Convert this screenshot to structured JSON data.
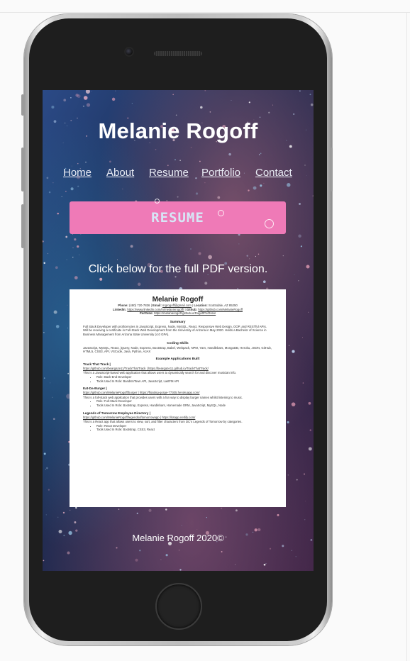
{
  "site": {
    "title": "Melanie Rogoff",
    "nav": [
      "Home",
      "About",
      "Resume",
      "Portfolio",
      "Contact"
    ],
    "banner": "RESUME",
    "pdf_note": "Click below for the full PDF version.",
    "footer": "Melanie Rogoff 2020©"
  },
  "resume": {
    "name": "Melanie Rogoff",
    "contact_line": {
      "phone_label": "Phone:",
      "phone": "(480) 720-7836",
      "email_label": "Email:",
      "email": "mgrogoff@gmail.com",
      "location_label": "Location:",
      "location": "Scottsdale, AZ 85250"
    },
    "links_line": {
      "linkedin_label": "LinkedIn:",
      "linkedin": "https://www.linkedin.com/in/melanierogoff/",
      "github_label": "Github:",
      "github": "https://github.com/MelanieRogoff"
    },
    "portfolio_line": {
      "label": "Portfolio:",
      "url": "https://melanierogoff.github.io/RogoffPortfolio/"
    },
    "summary_heading": "Summary",
    "summary": "Full Stack Developer with proficiencies in JavaScript, Express, Node, MySQL, React, Responsive Web Design, OOP, and RESTful APIs. Will be receiving a certificate in Full-Stack Web Development from the University of Arizona in May 2020. Holds a Bachelor of Science in Business Management from Arizona State University (4.0 GPA).",
    "skills_heading": "Coding Skills",
    "skills": "JavaScript, MySQL, React, jQuery, Node, Express, Bootstrap, Babel, Webpack, NPM, Yarn, Handlebars, MongoDB, Heroku, JSON, GitHub, HTML5, CSS3, API, VSCode, Java, Python, AJAX",
    "apps_heading": "Example Applications Built",
    "apps": [
      {
        "name": "Track That Track |",
        "links": "https://github.com/beargaze11/TrackThatTrack | https://beargaze11.github.io/TrackThatTrack/",
        "desc": "This is a JavaScript-based web application that allows users to dynamically search for and discover musician info.",
        "bullets": [
          "Role: Back-End Developer",
          "Tools Used In Role: BandsInTown API, JavaScript, LastFM API"
        ]
      },
      {
        "name": "Eat-Da-Burger |",
        "links": "https://github.com/MelanieRogoff/burger | https://floating-gorge-77305.herokuapp.com/",
        "desc": "This is a full-stack web application that provides users with a fun way to display burger names whilst listening to music.",
        "bullets": [
          "Role: Full-Stack Developer",
          "Tools Used In Role: Bootstrap, Express, Handlebars, Homemade ORM, JavaScript, MySQL, Node"
        ]
      },
      {
        "name": "Legends of Tomorrow Employee Directory |",
        "links": "https://github.com/MelanieRogoff/legendsoftomorrowapp | https://lotapp.netlify.com/",
        "desc": "This is a React app that allows users to view, sort, and filter characters from DC's Legends of Tomorrow by categories.",
        "bullets": [
          "Role: React Developer",
          "Tools Used In Role: Bootstrap, CSS3, React"
        ]
      }
    ]
  },
  "colors": {
    "banner": "#ef7ab7",
    "banner_text": "#d7e6f6",
    "page_background": "#fafafa"
  }
}
